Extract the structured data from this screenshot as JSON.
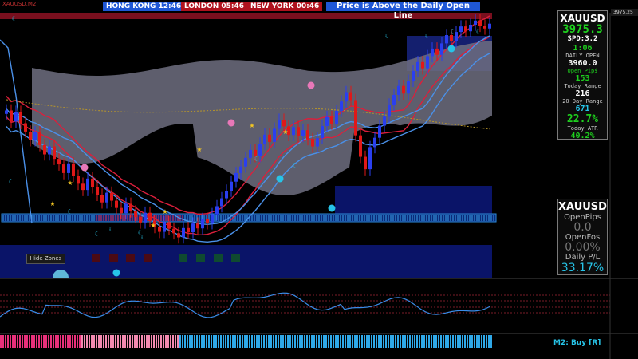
{
  "clocks": [
    {
      "label": "HONG KONG 12:46"
    },
    {
      "label": "LONDON  05:46"
    },
    {
      "label": "NEW YORK  00:46"
    }
  ],
  "alert_text": "Price is Above the Daily Open Line",
  "panel_main": {
    "symbol": "XAUUSD",
    "price": "3975.3",
    "spread": "SPD:3.2",
    "timer": "1:06",
    "daily_open_label": "DAILY OPEN",
    "daily_open_value": "3960.0",
    "open_pips_label": "Open Pip$",
    "open_pips_value": "153",
    "today_range_label": "Today Range",
    "today_range_value": "216",
    "twenty_day_label": "20 Day Range",
    "twenty_day_value": "671",
    "range_pct": "22.7%",
    "atr_label": "Today ATR",
    "atr_value": "40.2%"
  },
  "panel_account": {
    "symbol": "XAUUSD",
    "open_pips_label": "OpenPips",
    "open_pips_value": "0.0",
    "open_pos_label": "OpenFos",
    "open_pos_value": "0.00%",
    "daily_pl_label": "Daily P/L",
    "daily_pl_value": "33.17%"
  },
  "hide_zones_label": "Hide Zones",
  "signal_label": "M2: Buy [R]",
  "price_tag": "3975.25",
  "colors": {
    "bull": "#2a3ff0",
    "bear": "#e01818",
    "cloud": "#6e6e80",
    "accent": "#27c4e8",
    "band_upper": "#4a90e8",
    "band_lower": "#dc1f3c"
  },
  "chart_data": {
    "type": "candlestick",
    "close": [
      3964.2,
      3961.0,
      3963.8,
      3960.5,
      3958.1,
      3955.6,
      3957.9,
      3954.2,
      3951.5,
      3953.8,
      3950.2,
      3948.6,
      3946.1,
      3948.9,
      3945.3,
      3943.0,
      3941.2,
      3944.5,
      3942.0,
      3939.8,
      3937.6,
      3940.4,
      3938.1,
      3936.0,
      3934.5,
      3937.2,
      3935.0,
      3933.4,
      3931.8,
      3934.6,
      3932.3,
      3930.5,
      3929.1,
      3931.9,
      3930.0,
      3928.7,
      3927.5,
      3930.2,
      3929.0,
      3931.5,
      3930.1,
      3932.8,
      3931.6,
      3934.2,
      3936.5,
      3938.8,
      3941.0,
      3943.6,
      3946.1,
      3948.0,
      3950.5,
      3952.8,
      3951.0,
      3954.6,
      3957.2,
      3955.1,
      3958.9,
      3961.5,
      3959.6,
      3957.1,
      3959.4,
      3956.8,
      3958.5,
      3955.9,
      3953.8,
      3956.2,
      3959.7,
      3962.3,
      3960.4,
      3964.1,
      3966.8,
      3969.5,
      3967.2,
      3957.0,
      3950.8,
      3947.2,
      3953.6,
      3956.3,
      3959.8,
      3962.4,
      3965.9,
      3968.7,
      3971.3,
      3969.1,
      3972.8,
      3975.6,
      3978.2,
      3976.4,
      3979.9,
      3982.1,
      3980.3,
      3983.6,
      3986.0,
      3984.2,
      3986.9,
      3988.5,
      3987.1,
      3989.0,
      3990.2,
      3988.7,
      3987.9,
      3989.3
    ]
  }
}
